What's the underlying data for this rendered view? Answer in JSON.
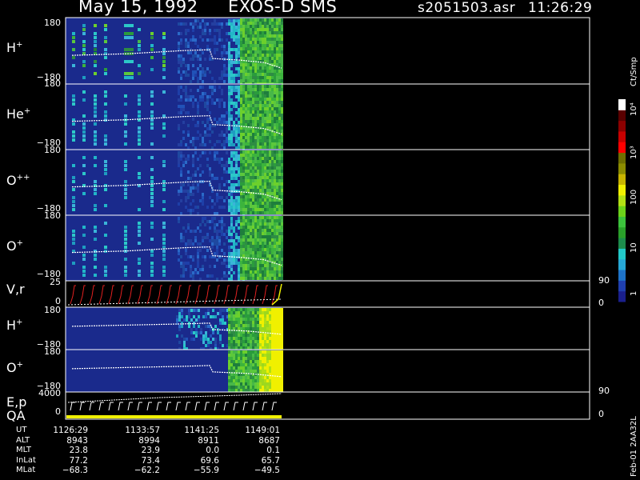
{
  "header": {
    "date": "May 15, 1992",
    "instrument": "EXOS-D SMS",
    "file": "s2051503.asr",
    "time": "11:26:29"
  },
  "colorbar": {
    "unit": "Ct/Smp",
    "ticks": [
      "1",
      "10",
      "100",
      "10³",
      "10⁴"
    ],
    "colors": [
      "#1a1f8c",
      "#1f3fae",
      "#1e73c8",
      "#27a8d6",
      "#22c9c9",
      "#1d8c4c",
      "#2aa02a",
      "#3cc23c",
      "#6cd21a",
      "#b2e014",
      "#f0f000",
      "#c8b400",
      "#8c8c00",
      "#6e6e00",
      "#ff0000",
      "#c80000",
      "#8c0000",
      "#5a0000",
      "#ffffff"
    ]
  },
  "panels": [
    {
      "label": "H",
      "sup": "+",
      "top": "180",
      "bottom": "−180"
    },
    {
      "label": "He",
      "sup": "+",
      "top": "180",
      "bottom": "−180"
    },
    {
      "label": "O",
      "sup": "++",
      "top": "180",
      "bottom": "−180"
    },
    {
      "label": "O",
      "sup": "+",
      "top": "180",
      "bottom": "−180"
    },
    {
      "label": "V,r",
      "sup": "",
      "top": "25",
      "bottom": "0",
      "rtop": "90",
      "rbottom": "0"
    },
    {
      "label": "H",
      "sup": "+",
      "top": "180",
      "bottom": "−180"
    },
    {
      "label": "O",
      "sup": "+",
      "top": "180",
      "bottom": "−180"
    },
    {
      "label": "E,p",
      "sup": "",
      "label2": "QA",
      "top": "4000",
      "bottom": "0",
      "rtop": "90",
      "rbottom": "0"
    }
  ],
  "footer": {
    "rows": [
      "UT",
      "ALT",
      "MLT",
      "InLat",
      "MLat"
    ],
    "columns": [
      [
        "1126:29",
        "8943",
        "23.8",
        "77.2",
        "−68.3"
      ],
      [
        "1133:57",
        "8994",
        "23.9",
        "73.4",
        "−62.2"
      ],
      [
        "1141:25",
        "8911",
        "0.0",
        "69.6",
        "−55.9"
      ],
      [
        "1149:01",
        "8687",
        "0.1",
        "65.7",
        "−49.5"
      ]
    ],
    "stamp": "Feb-01 2AA32L"
  }
}
